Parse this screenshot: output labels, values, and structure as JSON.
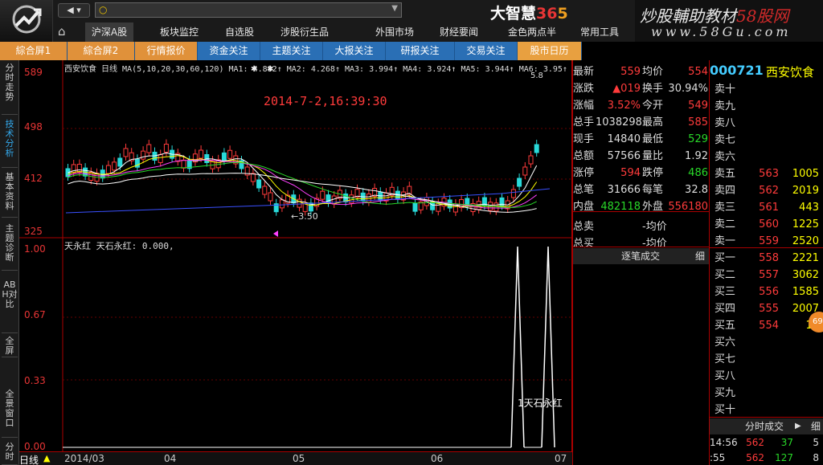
{
  "app": {
    "brand_a": "大智慧",
    "brand_b": "36",
    "brand_c": "5"
  },
  "watermark": {
    "line1_a": "炒股輔助教材",
    "line1_b": "58股网",
    "line2": "www.58Gu.com"
  },
  "search": {
    "placeholder": ""
  },
  "menu": [
    "沪深A股",
    "板块监控",
    "自选股",
    "涉股衍生品",
    "外围市场",
    "财经要闻",
    "金色两点半",
    "常用工具"
  ],
  "tabs": [
    "綜合屏1",
    "綜合屏2",
    "行情报价",
    "资金关注",
    "主题关注",
    "大报关注",
    "研报关注",
    "交易关注",
    "股市日历"
  ],
  "left_tabs": [
    "分时走势",
    "技术分析",
    "基本资料",
    "主题诊断",
    "ABH对比",
    "全屏",
    "全景窗口",
    "分时"
  ],
  "chart": {
    "header": "西安饮食 日线 MA(5,10,20,30,60,120) MA1: 4.882↑ MA2: 4.268↑ MA3: 3.994↑ MA4: 3.924↑ MA5: 3.944↑ MA6: 3.95↑",
    "timestamp": "2014-7-2,16:39:30",
    "y_labels": [
      "589",
      "498",
      "412",
      "325"
    ],
    "low_label": "3.50",
    "high_label": "5.8",
    "ind_header": "天永红  天石永红: 0.000,",
    "ind_y": [
      "1.00",
      "0.67",
      "0.33",
      "0.00"
    ],
    "ind_annot": "1天石永红",
    "x_labels": [
      "2014/03",
      "04",
      "05",
      "06",
      "07"
    ],
    "period": "日线",
    "colors": {
      "up": "#ff3b3b",
      "down": "#29d9d9",
      "ma1": "#ffffff",
      "ma2": "#ffff00",
      "ma3": "#ff40ff",
      "ma4": "#29d929",
      "ma5": "#ffffff",
      "ma6": "#3a50ff"
    }
  },
  "quote": {
    "rows": [
      {
        "l1": "最新",
        "v1": "559",
        "c1": "red",
        "l2": "均价",
        "v2": "554",
        "c2": "red"
      },
      {
        "l1": "涨跌",
        "v1": "▲019",
        "c1": "red",
        "l2": "换手",
        "v2": "30.94%",
        "c2": "white"
      },
      {
        "l1": "涨幅",
        "v1": "3.52%",
        "c1": "red",
        "l2": "今开",
        "v2": "549",
        "c2": "red"
      },
      {
        "l1": "总手",
        "v1": "1038298",
        "c1": "white",
        "l2": "最高",
        "v2": "585",
        "c2": "red"
      },
      {
        "l1": "现手",
        "v1": "14840",
        "c1": "white",
        "l2": "最低",
        "v2": "529",
        "c2": "green"
      },
      {
        "l1": "总额",
        "v1": "57566",
        "c1": "white",
        "l2": "量比",
        "v2": "1.92",
        "c2": "white"
      },
      {
        "l1": "涨停",
        "v1": "594",
        "c1": "red",
        "l2": "跌停",
        "v2": "486",
        "c2": "green"
      },
      {
        "l1": "总笔",
        "v1": "31666",
        "c1": "white",
        "l2": "每笔",
        "v2": "32.8",
        "c2": "white"
      },
      {
        "l1": "内盘",
        "v1": "482118",
        "c1": "green",
        "l2": "外盘",
        "v2": "556180",
        "c2": "red"
      },
      {
        "l1": "总卖",
        "v1": "",
        "c1": "white",
        "l2": "-均价",
        "v2": "",
        "c2": "white"
      },
      {
        "l1": "总买",
        "v1": "",
        "c1": "white",
        "l2": "-均价",
        "v2": "",
        "c2": "white"
      }
    ],
    "trades_title": "逐笔成交",
    "trades_more": "细"
  },
  "orderbook": {
    "code": "000721",
    "name": "西安饮食",
    "asks": [
      {
        "l": "卖十",
        "p": "",
        "v": ""
      },
      {
        "l": "卖九",
        "p": "",
        "v": ""
      },
      {
        "l": "卖八",
        "p": "",
        "v": ""
      },
      {
        "l": "卖七",
        "p": "",
        "v": ""
      },
      {
        "l": "卖六",
        "p": "",
        "v": ""
      },
      {
        "l": "卖五",
        "p": "563",
        "v": "1005"
      },
      {
        "l": "卖四",
        "p": "562",
        "v": "2019"
      },
      {
        "l": "卖三",
        "p": "561",
        "v": "443"
      },
      {
        "l": "卖二",
        "p": "560",
        "v": "1225"
      },
      {
        "l": "卖一",
        "p": "559",
        "v": "2520"
      }
    ],
    "bids": [
      {
        "l": "买一",
        "p": "558",
        "v": "2221"
      },
      {
        "l": "买二",
        "p": "557",
        "v": "3062"
      },
      {
        "l": "买三",
        "p": "556",
        "v": "1585"
      },
      {
        "l": "买四",
        "p": "555",
        "v": "2007"
      },
      {
        "l": "买五",
        "p": "554",
        "v": "11"
      },
      {
        "l": "买六",
        "p": "",
        "v": ""
      },
      {
        "l": "买七",
        "p": "",
        "v": ""
      },
      {
        "l": "买八",
        "p": "",
        "v": ""
      },
      {
        "l": "买九",
        "p": "",
        "v": ""
      },
      {
        "l": "买十",
        "p": "",
        "v": ""
      }
    ],
    "minute_title": "分时成交",
    "minute_more": "细",
    "ticks": [
      {
        "t": "14:56",
        "p": "562",
        "v": "37",
        "n": "5"
      },
      {
        "t": ":55",
        "p": "562",
        "v": "127",
        "n": "8"
      }
    ],
    "badge": "69"
  }
}
